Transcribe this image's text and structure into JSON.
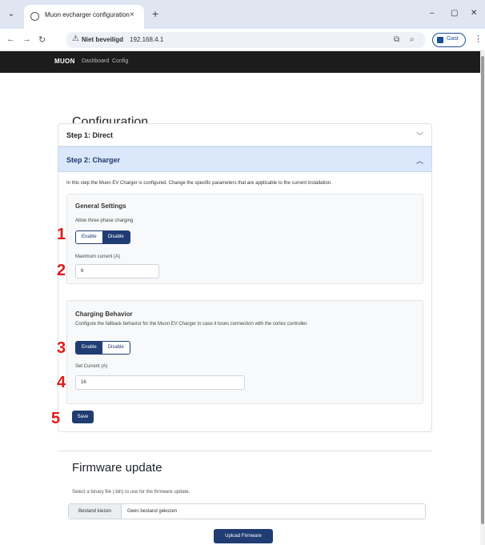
{
  "browser": {
    "tab_title": "Muon evcharger configuration",
    "tab_close": "×",
    "new_tab": "+",
    "insecure_label": "Niet beveiligd",
    "url": "192.168.4.1",
    "profile_label": "Gast",
    "window_controls": [
      "–",
      "▢",
      "✕"
    ]
  },
  "navbar": {
    "brand": "MUON",
    "links": [
      "Dashboard",
      "Config"
    ]
  },
  "page": {
    "title": "Configuration",
    "step1_title": "Step 1: Direct",
    "step2_title": "Step 2: Charger",
    "step2_intro": "In this step the Muon EV Charger is configured. Change the specific parameters that are applicable to the current installation.",
    "general": {
      "title": "General Settings",
      "three_phase_label": "Allow three phase charging",
      "enable_label": "Enable",
      "disable_label": "Disable",
      "max_current_label": "Maximum current (A)",
      "max_current_value": "6"
    },
    "behavior": {
      "title": "Charging Behavior",
      "description": "Configure the fallback behavior for the Muon EV Charger in case it loses connection with the cortex controller.",
      "enable_label": "Enable",
      "disable_label": "Disable",
      "set_current_label": "Set Current (A)",
      "set_current_value": "16"
    },
    "save_label": "Save",
    "firmware": {
      "title": "Firmware update",
      "description": "Select a binary file (.bin) to use for the firmware update.",
      "choose_file": "Bestand kiezen",
      "no_file": "Geen bestand gekozen",
      "upload_label": "Upload Firmware"
    }
  },
  "markers": [
    "1",
    "2",
    "3",
    "4",
    "5"
  ],
  "colors": {
    "primary": "#1f3c73",
    "accordion_active_bg": "#dbe7fb",
    "navbar_bg": "#1c1c1c",
    "marker": "#e01b1b"
  }
}
